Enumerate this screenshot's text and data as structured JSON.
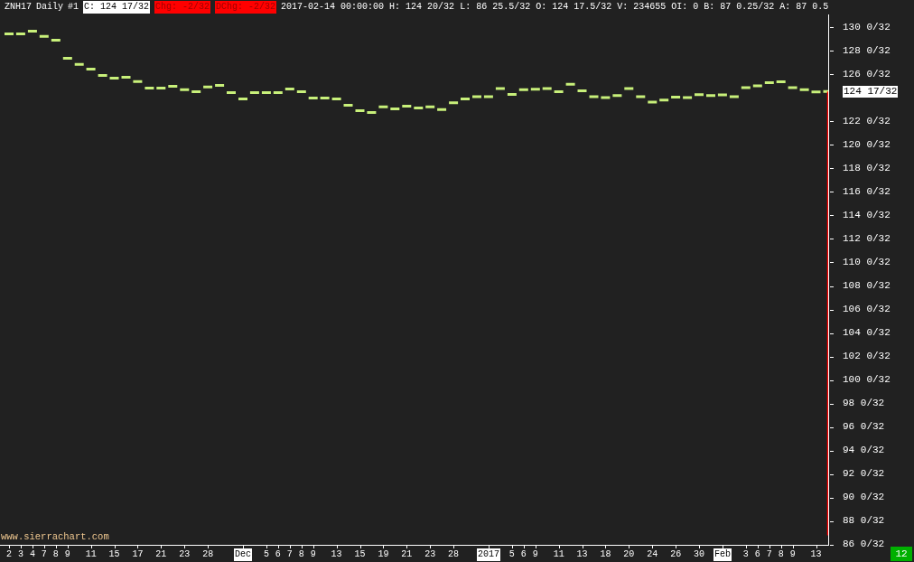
{
  "header": [
    {
      "text": "ZNH17",
      "kind": "plain"
    },
    {
      "text": "Daily",
      "kind": "plain"
    },
    {
      "text": "#1",
      "kind": "plain"
    },
    {
      "text": "C: 124 17/32",
      "kind": "white"
    },
    {
      "text": "Chg: -2/32",
      "kind": "red"
    },
    {
      "text": "DChg: -2/32",
      "kind": "red"
    },
    {
      "text": "2017-02-14 00:00:00 H: 124 20/32 L: 86 25.5/32 O: 124 17.5/32 V: 234655 OI: 0 B: 87 0.25/32 A: 87 0.5",
      "kind": "plain"
    }
  ],
  "chart": {
    "y_axis_labels": [
      "130 0/32",
      "128 0/32",
      "126 0/32",
      "122 0/32",
      "120 0/32",
      "118 0/32",
      "116 0/32",
      "114 0/32",
      "112 0/32",
      "110 0/32",
      "108 0/32",
      "106 0/32",
      "104 0/32",
      "102 0/32",
      "100 0/32",
      "98 0/32",
      "96 0/32",
      "94 0/32",
      "92 0/32",
      "90 0/32",
      "88 0/32",
      "86 0/32"
    ],
    "x_axis_labels": [
      {
        "text": "2",
        "highlighted": false
      },
      {
        "text": "3",
        "highlighted": false
      },
      {
        "text": "4",
        "highlighted": false
      },
      {
        "text": "7",
        "highlighted": false
      },
      {
        "text": "8",
        "highlighted": false
      },
      {
        "text": "9",
        "highlighted": false
      },
      {
        "text": "11",
        "highlighted": false
      },
      {
        "text": "15",
        "highlighted": false
      },
      {
        "text": "17",
        "highlighted": false
      },
      {
        "text": "21",
        "highlighted": false
      },
      {
        "text": "23",
        "highlighted": false
      },
      {
        "text": "28",
        "highlighted": false
      },
      {
        "text": "Dec",
        "highlighted": true
      },
      {
        "text": "5",
        "highlighted": false
      },
      {
        "text": "6",
        "highlighted": false
      },
      {
        "text": "7",
        "highlighted": false
      },
      {
        "text": "8",
        "highlighted": false
      },
      {
        "text": "9",
        "highlighted": false
      },
      {
        "text": "13",
        "highlighted": false
      },
      {
        "text": "15",
        "highlighted": false
      },
      {
        "text": "19",
        "highlighted": false
      },
      {
        "text": "21",
        "highlighted": false
      },
      {
        "text": "23",
        "highlighted": false
      },
      {
        "text": "28",
        "highlighted": false
      },
      {
        "text": "2017",
        "highlighted": true
      },
      {
        "text": "5",
        "highlighted": false
      },
      {
        "text": "6",
        "highlighted": false
      },
      {
        "text": "9",
        "highlighted": false
      },
      {
        "text": "11",
        "highlighted": false
      },
      {
        "text": "13",
        "highlighted": false
      },
      {
        "text": "18",
        "highlighted": false
      },
      {
        "text": "20",
        "highlighted": false
      },
      {
        "text": "24",
        "highlighted": false
      },
      {
        "text": "26",
        "highlighted": false
      },
      {
        "text": "30",
        "highlighted": false
      },
      {
        "text": "Feb",
        "highlighted": true
      },
      {
        "text": "3",
        "highlighted": false
      },
      {
        "text": "6",
        "highlighted": false
      },
      {
        "text": "7",
        "highlighted": false
      },
      {
        "text": "8",
        "highlighted": false
      },
      {
        "text": "9",
        "highlighted": false
      },
      {
        "text": "13",
        "highlighted": false
      }
    ],
    "price_marker": "124 17/32",
    "watermark_link": "www.sierrachart.com",
    "status_badge": "12"
  }
}
